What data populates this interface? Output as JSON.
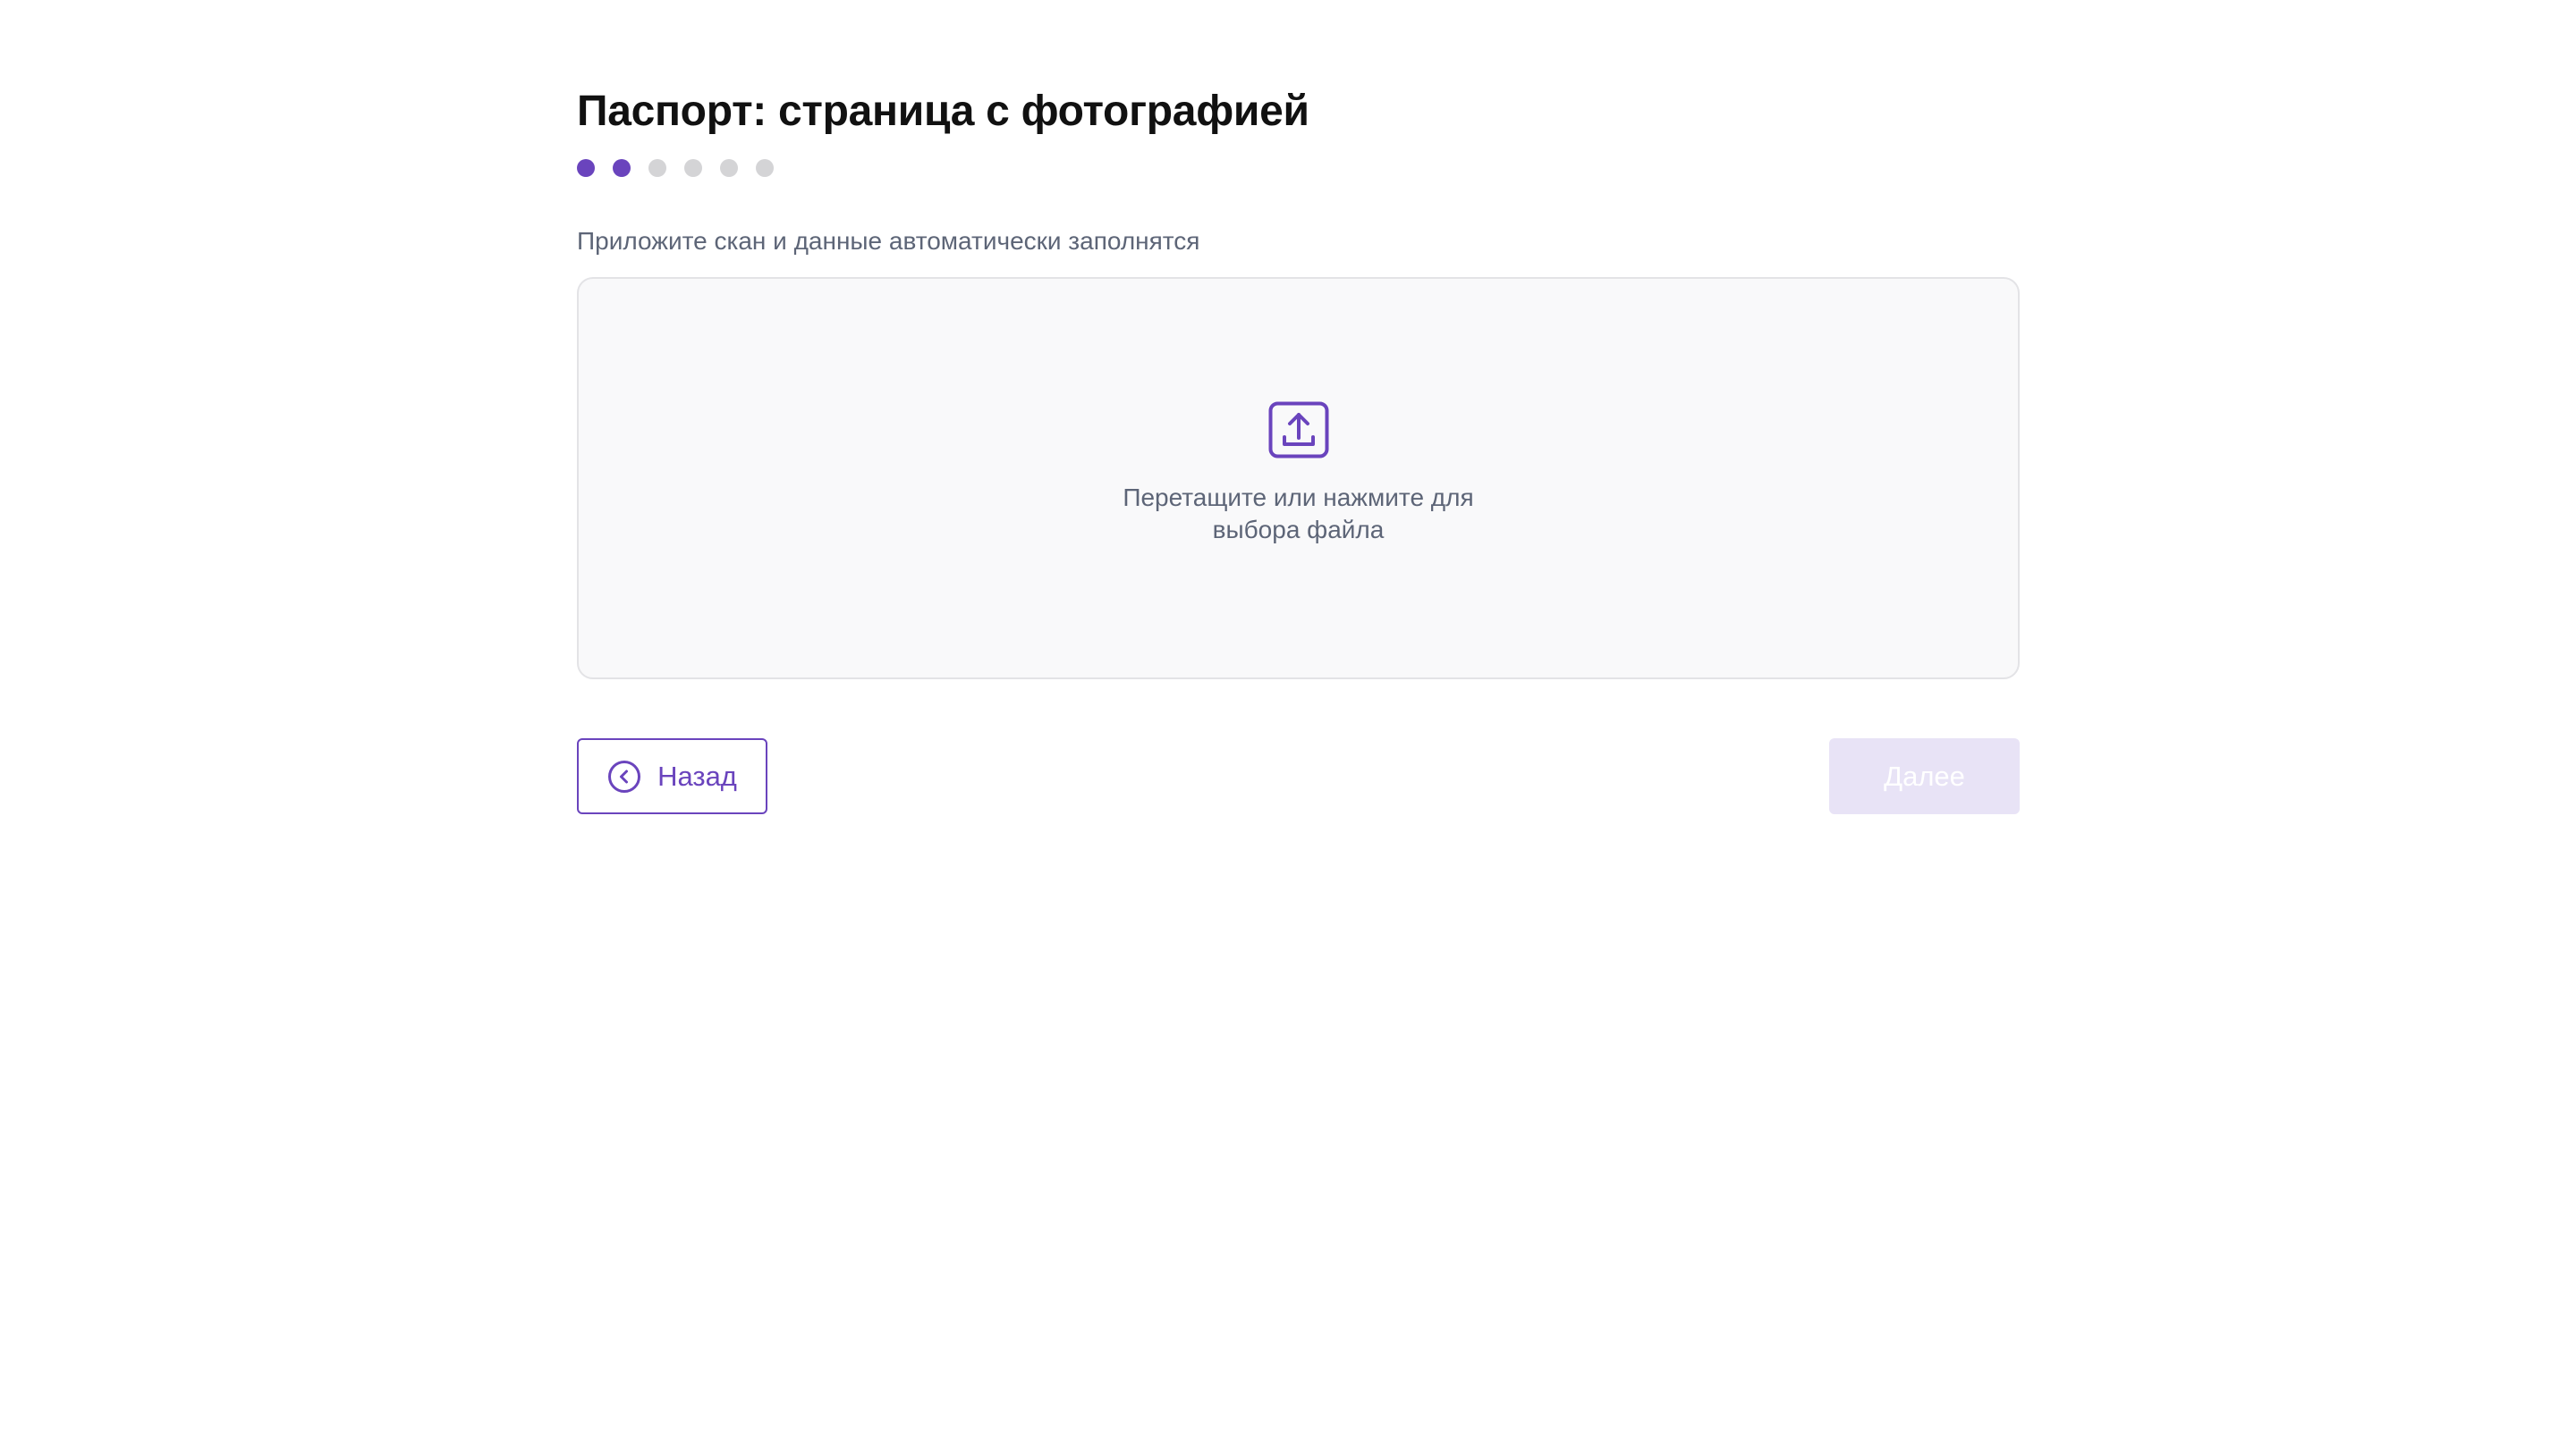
{
  "page": {
    "title": "Паспорт: страница с фотографией",
    "hint": "Приложите скан и данные автоматически заполнятся"
  },
  "steps": {
    "total": 6,
    "completed": 2,
    "active_color": "#6a44bd",
    "inactive_color": "#d4d4d6"
  },
  "dropzone": {
    "icon": "upload-icon",
    "line1": "Перетащите или нажмите для",
    "line2": "выбора файла"
  },
  "actions": {
    "back_label": "Назад",
    "back_icon": "chevron-left-circle-icon",
    "next_label": "Далее",
    "next_disabled": true
  },
  "colors": {
    "accent": "#6a44bd",
    "text_muted": "#5d6577",
    "dropzone_bg": "#f9f9fa",
    "disabled_button_bg": "#e8e3f6"
  }
}
